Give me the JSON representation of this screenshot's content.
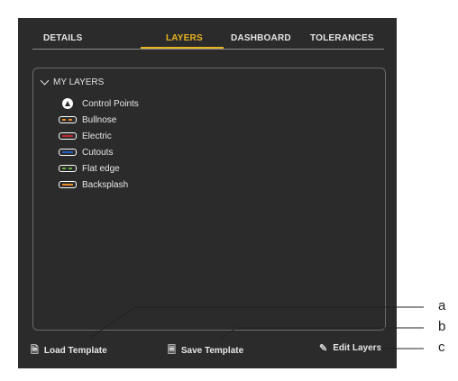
{
  "tabs": [
    {
      "label": "DETAILS"
    },
    {
      "label": "LAYERS"
    },
    {
      "label": "DASHBOARD"
    },
    {
      "label": "TOLERANCES"
    }
  ],
  "active_tab": "LAYERS",
  "layers": {
    "header": "MY LAYERS",
    "control_points": "Control Points",
    "items": [
      {
        "label": "Bullnose",
        "color": "#e88a2a",
        "style": "dashed"
      },
      {
        "label": "Electric",
        "color": "#c0262c",
        "style": "solid"
      },
      {
        "label": "Cutouts",
        "color": "#1f5fbf",
        "style": "solid"
      },
      {
        "label": "Flat edge",
        "color": "#5fb33a",
        "style": "dashed"
      },
      {
        "label": "Backsplash",
        "color": "#e88a2a",
        "style": "solid"
      }
    ]
  },
  "footer": {
    "load_label": "Load Template",
    "save_label": "Save Template",
    "edit_label": "Edit Layers"
  },
  "callouts": {
    "a": "a",
    "b": "b",
    "c": "c"
  }
}
